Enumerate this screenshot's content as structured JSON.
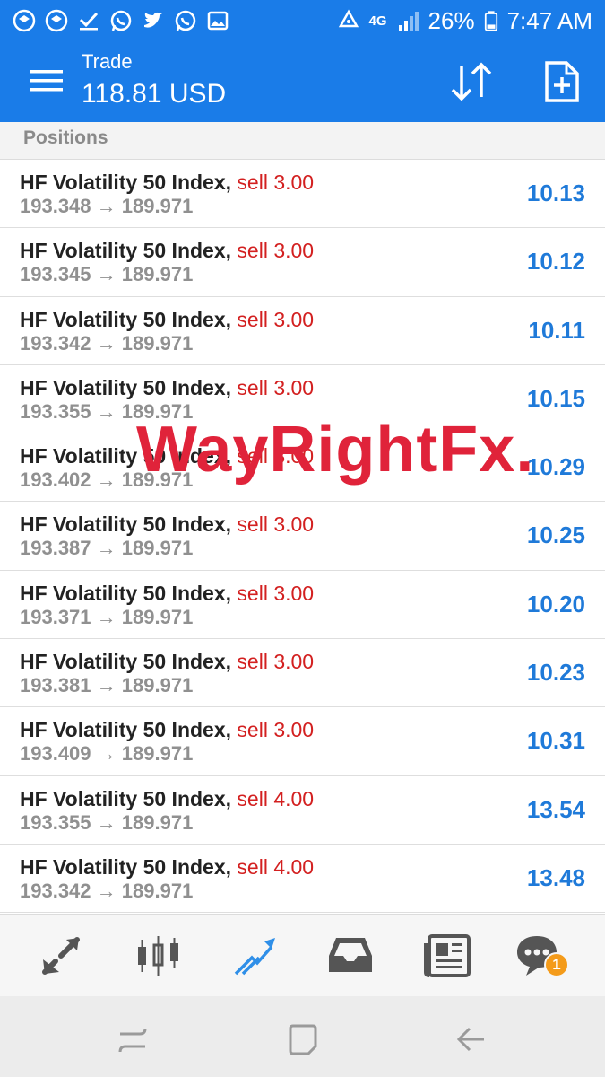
{
  "status": {
    "network": "4G",
    "battery": "26%",
    "time": "7:47 AM"
  },
  "header": {
    "title": "Trade",
    "balance": "118.81 USD"
  },
  "section": {
    "title": "Positions"
  },
  "positions": [
    {
      "symbol": "HF Volatility 50 Index,",
      "side": "sell 3.00",
      "open_price": "193.348",
      "arrow": "→",
      "current_price": "189.971",
      "profit": "10.13"
    },
    {
      "symbol": "HF Volatility 50 Index,",
      "side": "sell 3.00",
      "open_price": "193.345",
      "arrow": "→",
      "current_price": "189.971",
      "profit": "10.12"
    },
    {
      "symbol": "HF Volatility 50 Index,",
      "side": "sell 3.00",
      "open_price": "193.342",
      "arrow": "→",
      "current_price": "189.971",
      "profit": "10.11"
    },
    {
      "symbol": "HF Volatility 50 Index,",
      "side": "sell 3.00",
      "open_price": "193.355",
      "arrow": "→",
      "current_price": "189.971",
      "profit": "10.15"
    },
    {
      "symbol": "HF Volatility 50 Index,",
      "side": "sell 3.00",
      "open_price": "193.402",
      "arrow": "→",
      "current_price": "189.971",
      "profit": "10.29"
    },
    {
      "symbol": "HF Volatility 50 Index,",
      "side": "sell 3.00",
      "open_price": "193.387",
      "arrow": "→",
      "current_price": "189.971",
      "profit": "10.25"
    },
    {
      "symbol": "HF Volatility 50 Index,",
      "side": "sell 3.00",
      "open_price": "193.371",
      "arrow": "→",
      "current_price": "189.971",
      "profit": "10.20"
    },
    {
      "symbol": "HF Volatility 50 Index,",
      "side": "sell 3.00",
      "open_price": "193.381",
      "arrow": "→",
      "current_price": "189.971",
      "profit": "10.23"
    },
    {
      "symbol": "HF Volatility 50 Index,",
      "side": "sell 3.00",
      "open_price": "193.409",
      "arrow": "→",
      "current_price": "189.971",
      "profit": "10.31"
    },
    {
      "symbol": "HF Volatility 50 Index,",
      "side": "sell 4.00",
      "open_price": "193.355",
      "arrow": "→",
      "current_price": "189.971",
      "profit": "13.54"
    },
    {
      "symbol": "HF Volatility 50 Index,",
      "side": "sell 4.00",
      "open_price": "193.342",
      "arrow": "→",
      "current_price": "189.971",
      "profit": "13.48"
    }
  ],
  "watermark": "WayRightFx.",
  "bottom_nav": {
    "items": [
      {
        "icon": "quotes-icon"
      },
      {
        "icon": "chart-icon"
      },
      {
        "icon": "trade-icon",
        "active": true
      },
      {
        "icon": "history-icon"
      },
      {
        "icon": "news-icon"
      },
      {
        "icon": "chat-icon",
        "badge": "1"
      }
    ]
  },
  "colors": {
    "primary": "#1a7ce8",
    "sell": "#d32020",
    "profit": "#1f7ad9",
    "watermark": "#e0233a",
    "badge": "#f49b1a"
  }
}
